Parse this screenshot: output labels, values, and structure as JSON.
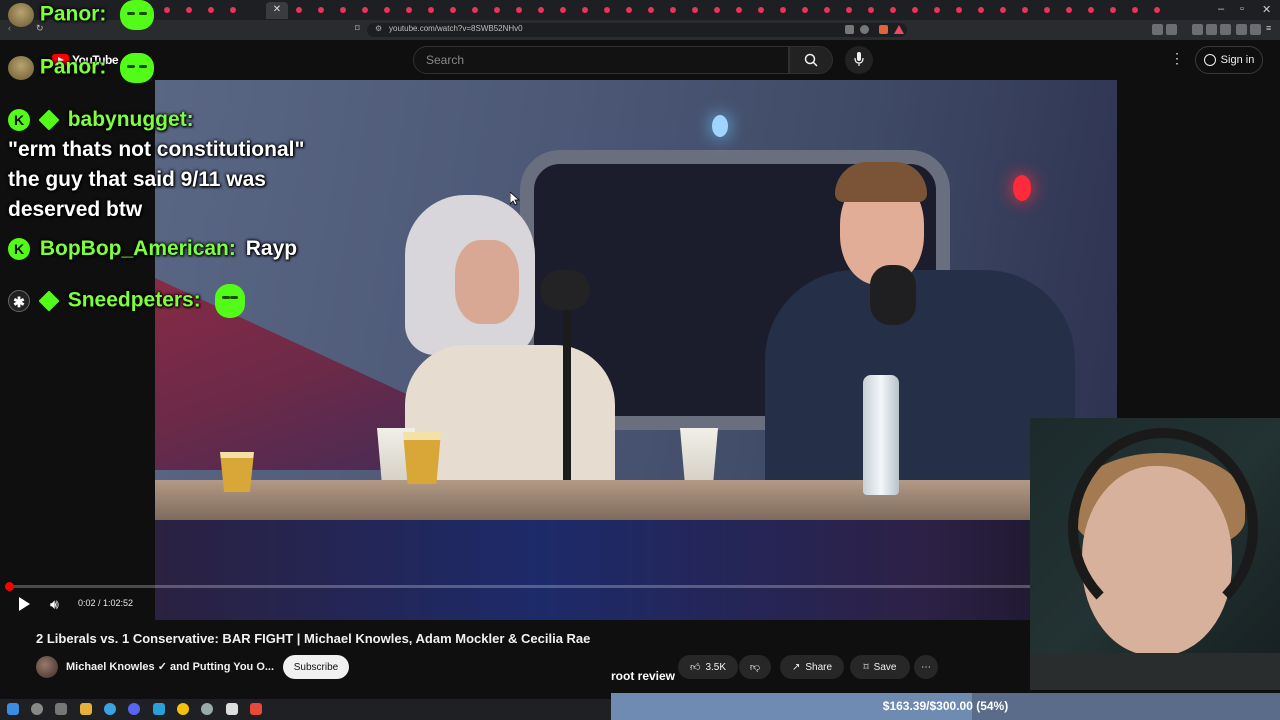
{
  "browser": {
    "url": "youtube.com/watch?v=8SWB52NHv0"
  },
  "youtube": {
    "logo_text": "YouTube",
    "search_placeholder": "Search",
    "signin_label": "Sign in"
  },
  "player": {
    "time": "0:02 / 1:02:52",
    "progress_fraction": 0.0005
  },
  "video": {
    "title": "2 Liberals vs. 1 Conservative: BAR FIGHT | Michael Knowles, Adam Mockler & Cecilia Rae",
    "channel": "Michael Knowles ✓ and Putting You O...",
    "subscribe_label": "Subscribe",
    "likes": "3.5K",
    "share_label": "Share",
    "save_label": "Save"
  },
  "chat": {
    "messages": [
      {
        "user": "Panor:",
        "text": ""
      },
      {
        "user": "Panor:",
        "text": ""
      },
      {
        "user": "babynugget:",
        "text_lines": [
          "\"erm thats not constitutional\"",
          "the guy that said 9/11 was",
          "deserved btw"
        ]
      },
      {
        "user": "BopBop_American:",
        "text": "Rayp"
      },
      {
        "user": "Sneedpeters:",
        "text": ""
      }
    ]
  },
  "overlay": {
    "goal_label": "root review",
    "goal_text": "$163.39/$300.00 (54%)",
    "goal_fraction": 0.54
  },
  "colors": {
    "kick_green": "#53fc18",
    "youtube_red": "#ff0000"
  }
}
